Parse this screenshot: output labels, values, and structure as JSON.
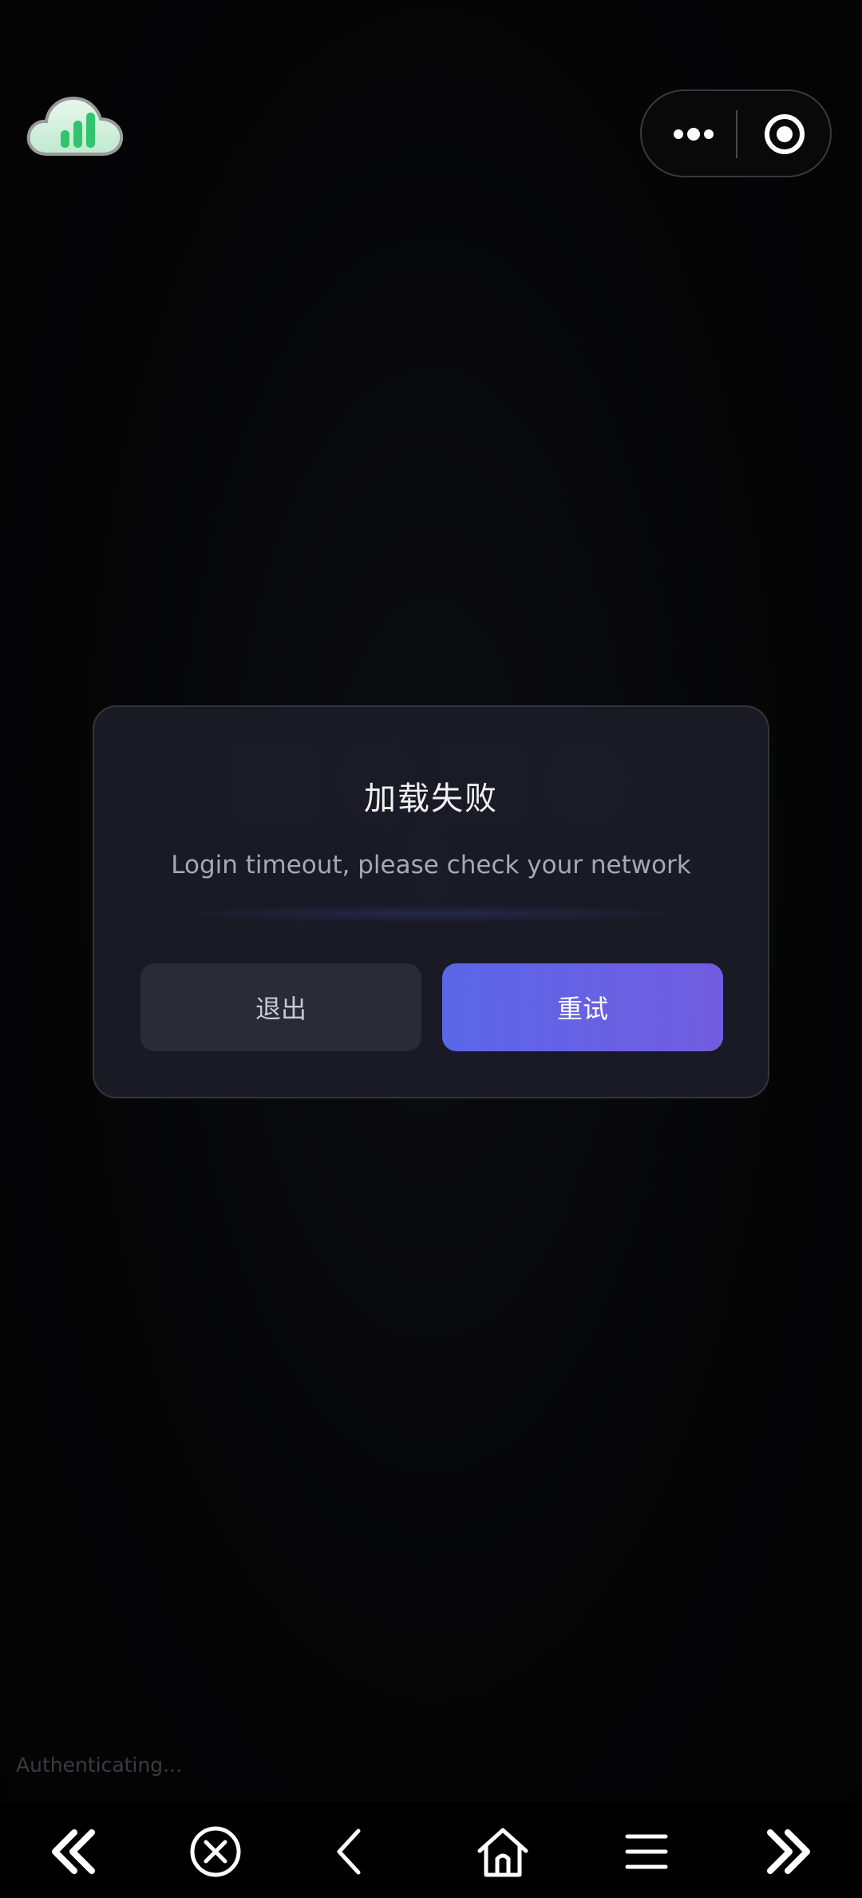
{
  "header": {
    "logo_icon": "cloud-chart-logo-icon",
    "capsule": {
      "more_icon": "more-dots-icon",
      "close_icon": "target-close-icon"
    }
  },
  "dialog": {
    "title": "加载失败",
    "message": "Login timeout, please check your network",
    "exit_label": "退出",
    "retry_label": "重试"
  },
  "status": {
    "text": "Authenticating..."
  },
  "bottom_nav": {
    "items": [
      {
        "icon": "double-chevron-left-icon"
      },
      {
        "icon": "close-circle-icon"
      },
      {
        "icon": "chevron-left-icon"
      },
      {
        "icon": "home-icon"
      },
      {
        "icon": "menu-icon"
      },
      {
        "icon": "double-chevron-right-icon"
      }
    ]
  },
  "colors": {
    "background": "#050506",
    "dialog_bg": "#1c1c28",
    "retry_start": "#5a67e6",
    "retry_end": "#725ce0",
    "logo_green": "#3fd17a"
  }
}
